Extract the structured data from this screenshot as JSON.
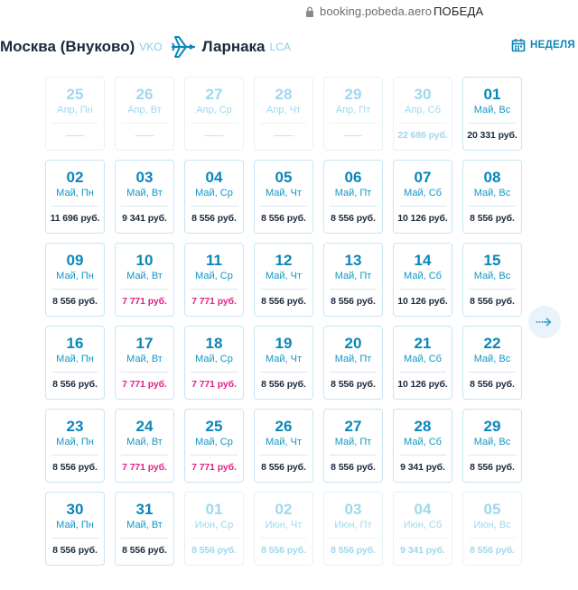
{
  "browser": {
    "url": "booking.pobeda.aero",
    "site_name": "ПОБЕДА"
  },
  "route": {
    "from_city": "Москва (Внуково)",
    "from_code": "VKO",
    "to_city": "Ларнака",
    "to_code": "LCA"
  },
  "view_toggle": {
    "label": "НЕДЕЛЯ"
  },
  "colors": {
    "accent": "#0a86b9",
    "low_price": "#e0238a",
    "text_dark": "#1c2a3f",
    "faded": "#9fd8ec"
  },
  "calendar": {
    "cells": [
      {
        "day": "25",
        "weekday": "Апр, Пн",
        "price": "——",
        "state": "nodata"
      },
      {
        "day": "26",
        "weekday": "Апр, Вт",
        "price": "——",
        "state": "nodata"
      },
      {
        "day": "27",
        "weekday": "Апр, Ср",
        "price": "——",
        "state": "nodata"
      },
      {
        "day": "28",
        "weekday": "Апр, Чт",
        "price": "——",
        "state": "nodata"
      },
      {
        "day": "29",
        "weekday": "Апр, Пт",
        "price": "——",
        "state": "nodata"
      },
      {
        "day": "30",
        "weekday": "Апр, Сб",
        "price": "22 686 руб.",
        "state": "faded"
      },
      {
        "day": "01",
        "weekday": "Май, Вс",
        "price": "20 331 руб.",
        "state": "normal"
      },
      {
        "day": "02",
        "weekday": "Май, Пн",
        "price": "11 696 руб.",
        "state": "normal"
      },
      {
        "day": "03",
        "weekday": "Май, Вт",
        "price": "9 341 руб.",
        "state": "normal"
      },
      {
        "day": "04",
        "weekday": "Май, Ср",
        "price": "8 556 руб.",
        "state": "normal"
      },
      {
        "day": "05",
        "weekday": "Май, Чт",
        "price": "8 556 руб.",
        "state": "normal"
      },
      {
        "day": "06",
        "weekday": "Май, Пт",
        "price": "8 556 руб.",
        "state": "normal"
      },
      {
        "day": "07",
        "weekday": "Май, Сб",
        "price": "10 126 руб.",
        "state": "normal"
      },
      {
        "day": "08",
        "weekday": "Май, Вс",
        "price": "8 556 руб.",
        "state": "normal"
      },
      {
        "day": "09",
        "weekday": "Май, Пн",
        "price": "8 556 руб.",
        "state": "normal"
      },
      {
        "day": "10",
        "weekday": "Май, Вт",
        "price": "7 771 руб.",
        "state": "low"
      },
      {
        "day": "11",
        "weekday": "Май, Ср",
        "price": "7 771 руб.",
        "state": "low"
      },
      {
        "day": "12",
        "weekday": "Май, Чт",
        "price": "8 556 руб.",
        "state": "normal"
      },
      {
        "day": "13",
        "weekday": "Май, Пт",
        "price": "8 556 руб.",
        "state": "normal"
      },
      {
        "day": "14",
        "weekday": "Май, Сб",
        "price": "10 126 руб.",
        "state": "normal"
      },
      {
        "day": "15",
        "weekday": "Май, Вс",
        "price": "8 556 руб.",
        "state": "normal"
      },
      {
        "day": "16",
        "weekday": "Май, Пн",
        "price": "8 556 руб.",
        "state": "normal"
      },
      {
        "day": "17",
        "weekday": "Май, Вт",
        "price": "7 771 руб.",
        "state": "low"
      },
      {
        "day": "18",
        "weekday": "Май, Ср",
        "price": "7 771 руб.",
        "state": "low"
      },
      {
        "day": "19",
        "weekday": "Май, Чт",
        "price": "8 556 руб.",
        "state": "normal"
      },
      {
        "day": "20",
        "weekday": "Май, Пт",
        "price": "8 556 руб.",
        "state": "normal"
      },
      {
        "day": "21",
        "weekday": "Май, Сб",
        "price": "10 126 руб.",
        "state": "normal"
      },
      {
        "day": "22",
        "weekday": "Май, Вс",
        "price": "8 556 руб.",
        "state": "normal"
      },
      {
        "day": "23",
        "weekday": "Май, Пн",
        "price": "8 556 руб.",
        "state": "normal"
      },
      {
        "day": "24",
        "weekday": "Май, Вт",
        "price": "7 771 руб.",
        "state": "low"
      },
      {
        "day": "25",
        "weekday": "Май, Ср",
        "price": "7 771 руб.",
        "state": "low"
      },
      {
        "day": "26",
        "weekday": "Май, Чт",
        "price": "8 556 руб.",
        "state": "normal"
      },
      {
        "day": "27",
        "weekday": "Май, Пт",
        "price": "8 556 руб.",
        "state": "normal"
      },
      {
        "day": "28",
        "weekday": "Май, Сб",
        "price": "9 341 руб.",
        "state": "normal"
      },
      {
        "day": "29",
        "weekday": "Май, Вс",
        "price": "8 556 руб.",
        "state": "normal"
      },
      {
        "day": "30",
        "weekday": "Май, Пн",
        "price": "8 556 руб.",
        "state": "normal"
      },
      {
        "day": "31",
        "weekday": "Май, Вт",
        "price": "8 556 руб.",
        "state": "normal"
      },
      {
        "day": "01",
        "weekday": "Июн, Ср",
        "price": "8 556 руб.",
        "state": "faded"
      },
      {
        "day": "02",
        "weekday": "Июн, Чт",
        "price": "8 556 руб.",
        "state": "faded"
      },
      {
        "day": "03",
        "weekday": "Июн, Пт",
        "price": "8 556 руб.",
        "state": "faded"
      },
      {
        "day": "04",
        "weekday": "Июн, Сб",
        "price": "9 341 руб.",
        "state": "faded"
      },
      {
        "day": "05",
        "weekday": "Июн, Вс",
        "price": "8 556 руб.",
        "state": "faded"
      }
    ]
  }
}
